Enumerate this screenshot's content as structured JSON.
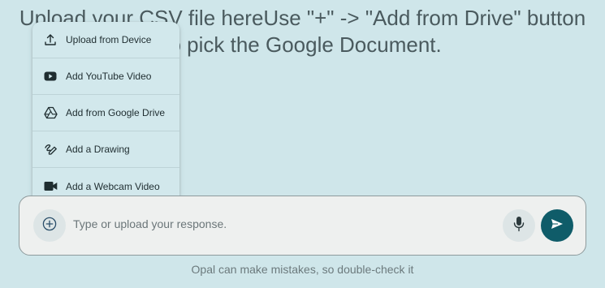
{
  "prompt": {
    "line1": "Upload your CSV file hereUse \"+\" -> \"Add from Drive\" button",
    "line2": "to pick the Google Document."
  },
  "menu": {
    "items": [
      {
        "label": "Upload from Device",
        "icon": "upload-icon"
      },
      {
        "label": "Add YouTube Video",
        "icon": "youtube-icon"
      },
      {
        "label": "Add from Google Drive",
        "icon": "google-drive-icon"
      },
      {
        "label": "Add a Drawing",
        "icon": "drawing-icon"
      },
      {
        "label": "Add a Webcam Video",
        "icon": "webcam-icon"
      }
    ]
  },
  "composer": {
    "placeholder": "Type or upload your response.",
    "add_icon": "add-circle-icon",
    "mic_icon": "microphone-icon",
    "send_icon": "send-icon"
  },
  "footer": {
    "disclaimer": "Opal can make mistakes, so double-check it"
  },
  "colors": {
    "background": "#cfe6ea",
    "send_button": "#0f5c69"
  }
}
